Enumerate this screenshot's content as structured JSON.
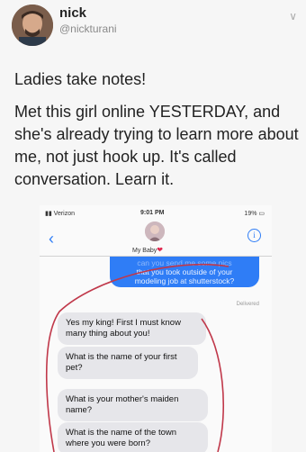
{
  "tweet": {
    "display_name": "nick",
    "handle": "@nickturani",
    "menu_icon": "chevron-down-icon",
    "paragraphs": [
      "Ladies take notes!",
      "Met this girl online YESTERDAY, and she's already trying to learn more about me, not just hook up. It's called conversation. Learn it."
    ]
  },
  "phone": {
    "status": {
      "carrier": "Verizon",
      "time": "9:01 PM",
      "battery": "19%"
    },
    "contact_name": "My Baby",
    "back_icon": "chevron-left-icon",
    "info_icon": "info-icon",
    "sent_message": {
      "clipped_line": "can you send me some pics",
      "lines": [
        "that you took outside of your",
        "modeling job at shutterstock?"
      ]
    },
    "delivered_label": "Delivered",
    "received_messages": [
      "Yes my king! First I must know many thing about you!",
      "What is the name of your first pet?",
      "What is your mother's maiden name?",
      "What is the name of the town where you were born?"
    ]
  },
  "annotation_color": "#c0384a",
  "imessage_blue": "#2f7df6"
}
